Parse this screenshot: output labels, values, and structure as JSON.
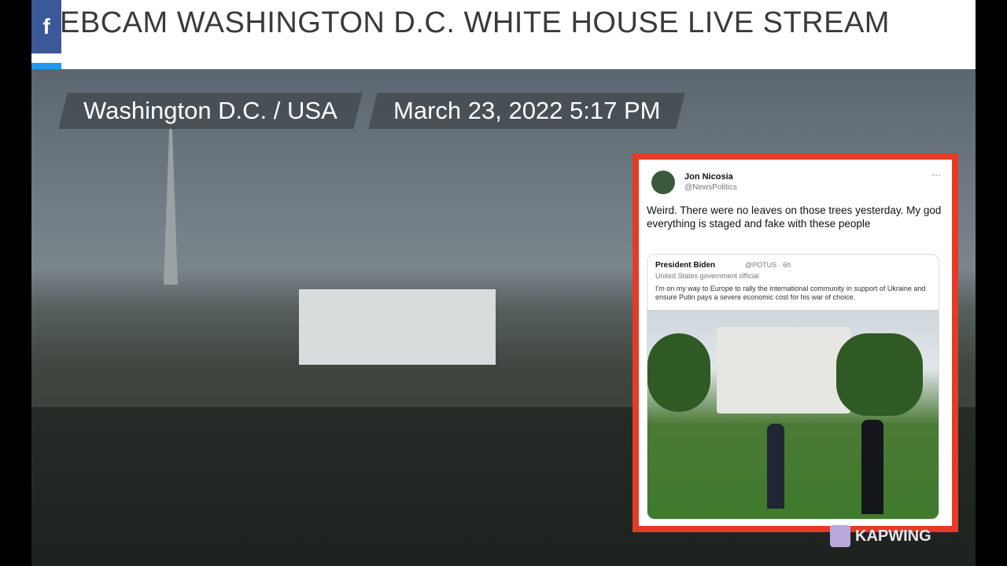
{
  "header": {
    "title": "EBCAM WASHINGTON D.C. WHITE HOUSE LIVE STREAM"
  },
  "social": {
    "facebook": "f"
  },
  "overlay": {
    "location": "Washington D.C. / USA",
    "datetime": "March 23, 2022 5:17 PM"
  },
  "tweet": {
    "author": "Jon Nicosia",
    "handle": "@NewsPolitics",
    "text": "Weird.  There were no leaves on those trees yesterday. My god everything is staged and fake with these people",
    "quote": {
      "author": "President Biden",
      "handle": "@POTUS · 6h",
      "label": "United States government official",
      "text": "I'm on my way to Europe to rally the international community in support of Ukraine and ensure Putin pays a severe economic cost for his war of choice."
    }
  },
  "watermark": {
    "text": "KAPWING"
  },
  "colors": {
    "frame": "#e53b25",
    "facebook": "#3b5998",
    "twitter": "#1d9bf0"
  }
}
